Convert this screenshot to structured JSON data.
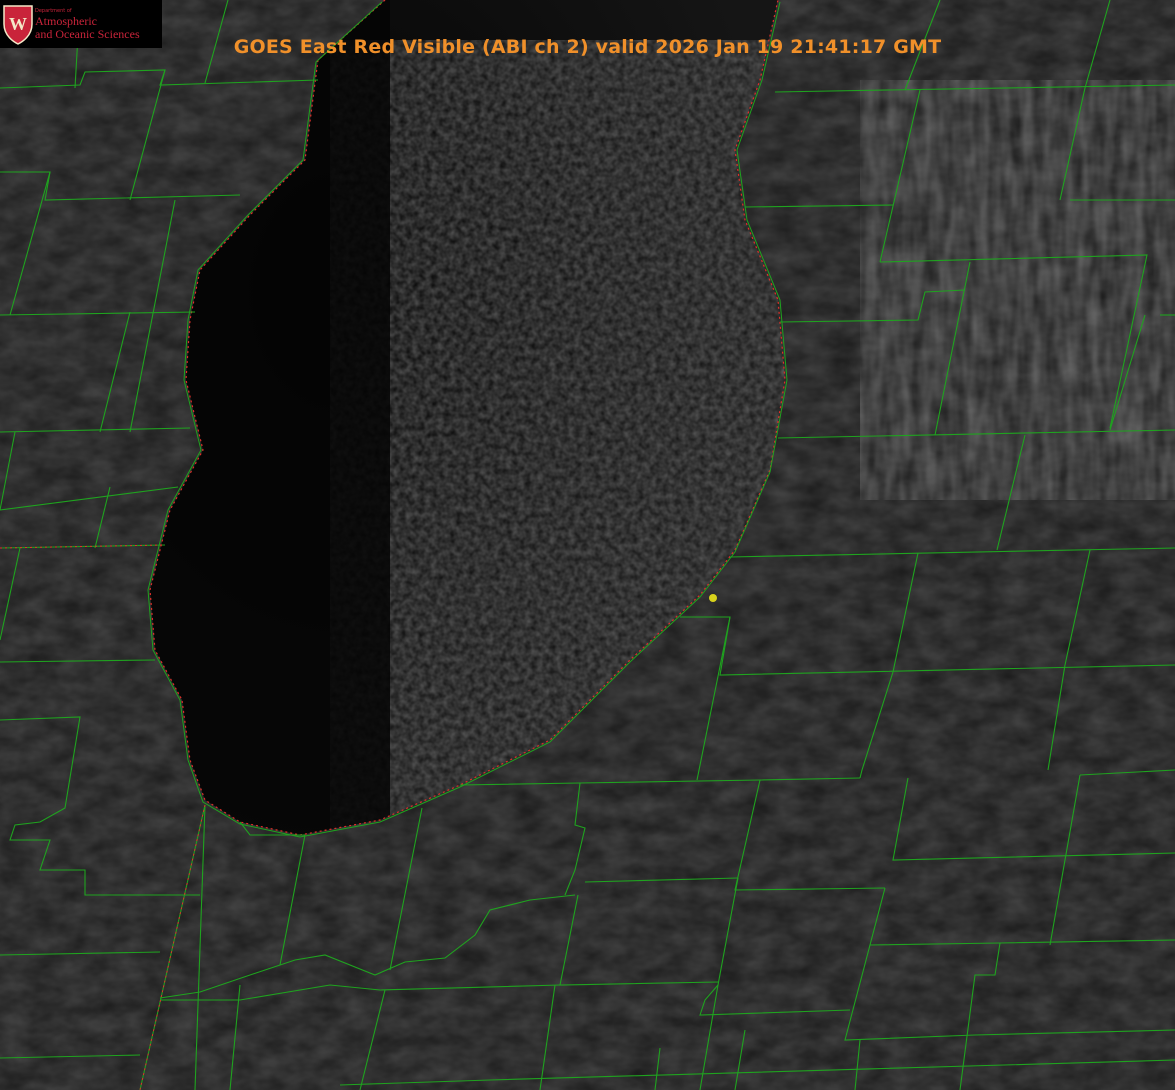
{
  "title": "GOES East Red Visible (ABI ch 2) valid 2026 Jan 19 21:41:17 GMT",
  "logo": {
    "department": "Department of",
    "line1": "Atmospheric",
    "line2": "and Oceanic Sciences",
    "crest_letter": "W"
  },
  "colors": {
    "title": "#f0902a",
    "boundaries": "#1fa31f",
    "coastline": "#e0302a",
    "marker": "#d8d21c",
    "logo_text": "#c9243a"
  },
  "icons": [
    "uw-crest-icon",
    "location-marker-icon"
  ]
}
